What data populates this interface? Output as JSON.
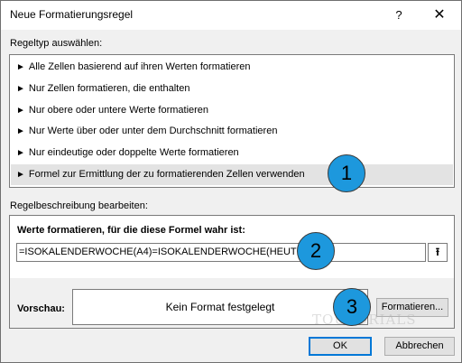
{
  "window": {
    "title": "Neue Formatierungsregel",
    "help_glyph": "?",
    "close_glyph": "✕"
  },
  "rule_type": {
    "label": "Regeltyp auswählen:",
    "items": [
      {
        "label": "Alle Zellen basierend auf ihren Werten formatieren"
      },
      {
        "label": "Nur Zellen formatieren, die enthalten"
      },
      {
        "label": "Nur obere oder untere Werte formatieren"
      },
      {
        "label": "Nur Werte über oder unter dem Durchschnitt formatieren"
      },
      {
        "label": "Nur eindeutige oder doppelte Werte formatieren"
      },
      {
        "label": "Formel zur Ermittlung der zu formatierenden Zellen verwenden"
      }
    ],
    "selected_index": 5,
    "bullet": "►"
  },
  "rule_description": {
    "label": "Regelbeschreibung bearbeiten:",
    "heading": "Werte formatieren, für die diese Formel wahr ist:",
    "formula": "=ISOKALENDERWOCHE(A4)=ISOKALENDERWOCHE(HEUTE())",
    "collapse_glyph": "⭱",
    "preview_label": "Vorschau:",
    "preview_text": "Kein Format festgelegt",
    "format_button": "Formatieren..."
  },
  "footer": {
    "ok_label": "OK",
    "cancel_label": "Abbrechen"
  },
  "callouts": [
    "1",
    "2",
    "3"
  ],
  "watermark": "TOUTORIALS",
  "colors": {
    "callout_fill": "#1d98dd",
    "selection": "#e3e3e3",
    "default_button_border": "#0078d7"
  }
}
